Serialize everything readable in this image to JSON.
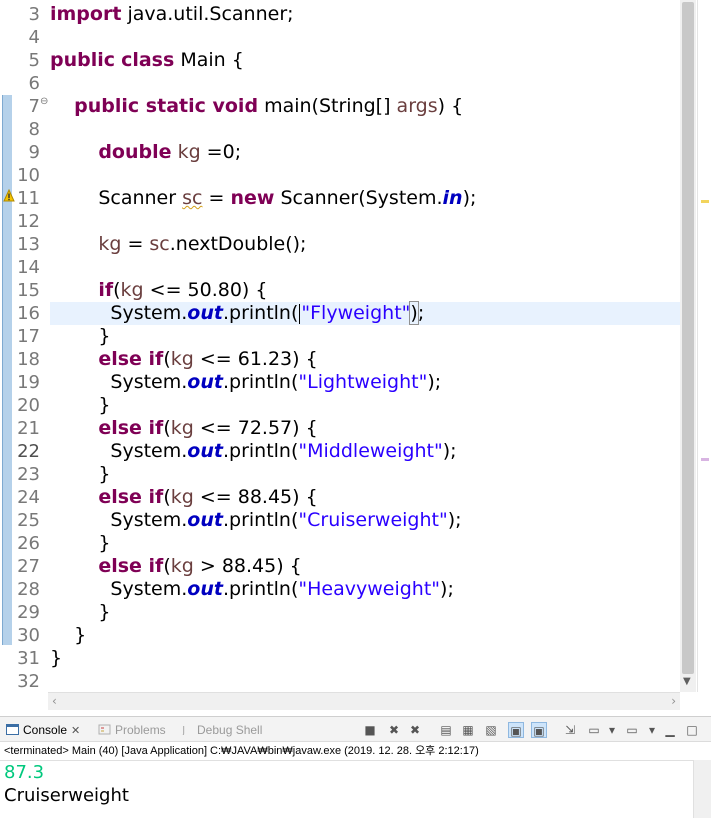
{
  "editor": {
    "line_numbers": [
      "3",
      "4",
      "5",
      "6",
      "7",
      "8",
      "9",
      "10",
      "11",
      "12",
      "13",
      "14",
      "15",
      "16",
      "17",
      "18",
      "19",
      "20",
      "21",
      "22",
      "23",
      "24",
      "25",
      "26",
      "27",
      "28",
      "29",
      "30",
      "31",
      "32"
    ],
    "code": {
      "l3_kw": "import",
      "l3_rest": " java.util.Scanner;",
      "l5_kw1": "public",
      "l5_kw2": "class",
      "l5_rest": " Main {",
      "l7_kw": "public static void",
      "l7_rest": " main(String[] ",
      "l7_var": "args",
      "l7_end": ") {",
      "l9_kw": "double",
      "l9_var": "kg",
      "l9_rest": " =0;",
      "l11_a": "Scanner ",
      "l11_var": "sc",
      "l11_b": " = ",
      "l11_kw": "new",
      "l11_c": " Scanner(System.",
      "l11_fld": "in",
      "l11_d": ");",
      "l13_var1": "kg",
      "l13_a": " = ",
      "l13_var2": "sc",
      "l13_b": ".nextDouble();",
      "l15_kw": "if",
      "l15_a": "(",
      "l15_var": "kg",
      "l15_b": " <= 50.80) {",
      "sys": "System.",
      "out": "out",
      "println": ".println(",
      "close": ");",
      "l16_str": "\"Flyweight\"",
      "brace": "}",
      "elseif": "else if",
      "l18_b": " <= 61.23) {",
      "l19_str": "\"Lightweight\"",
      "l21_b": " <= 72.57) {",
      "l22_str": "\"Middleweight\"",
      "l24_b": " <= 88.45) {",
      "l25_str": "\"Cruiserweight\"",
      "l27_b": " > 88.45) {",
      "l28_str": "\"Heavyweight\""
    }
  },
  "console": {
    "tabs": {
      "console": "Console",
      "problems": "Problems",
      "debug_shell": "Debug Shell"
    },
    "status": "<terminated> Main (40) [Java Application] C:₩JAVA₩bin₩javaw.exe (2019. 12. 28. 오후 2:12:17)",
    "output": {
      "input_line": "87.3",
      "result_line": "Cruiserweight"
    }
  },
  "colors": {
    "keyword": "#7f0055",
    "string": "#2a00ff",
    "field": "#0000c0",
    "variable": "#6a3e3e",
    "console_input": "#00c87d",
    "current_line": "#e8f2fe"
  }
}
